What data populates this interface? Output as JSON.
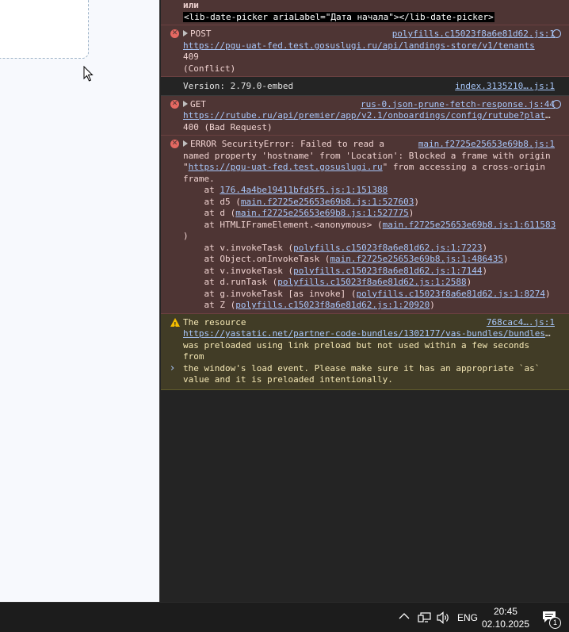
{
  "console": {
    "top_partial": {
      "line1": "или",
      "line2": "<lib-date-picker ariaLabel=\"Дата начала\"></lib-date-picker>"
    },
    "post_error": {
      "method": "POST",
      "source": "polyfills.c15023f8a6e81d62.js:1",
      "url": "https://pgu-uat-fed.test.gosuslugi.ru/api/landings-store/v1/tenants",
      "status_code": "409",
      "status_text": "(Conflict)"
    },
    "version_log": {
      "text": "Version: 2.79.0-embed",
      "source": "index.3135210….js:1"
    },
    "get_error": {
      "method": "GET",
      "source": "rus-0.json-prune-fetch-response.js:44",
      "url": "https://rutube.ru/api/premier/app/v2.1/onboardings/config/rutube?platf…",
      "status": "400 (Bad Request)"
    },
    "security_error": {
      "head": "ERROR SecurityError: Failed to read a",
      "source": "main.f2725e25653e69b8.js:1",
      "line2": "named property 'hostname' from 'Location': Blocked a frame with origin",
      "quote_open": "\"",
      "origin_url": "https://pgu-uat-fed.test.gosuslugi.ru",
      "line3_rest": "\" from accessing a cross-origin",
      "line4": "frame.",
      "stack": [
        {
          "prefix": "    at ",
          "link": "176.4a4be19411bfd5f5.js:1:151388",
          "suffix": ""
        },
        {
          "prefix": "    at d5 (",
          "link": "main.f2725e25653e69b8.js:1:527603",
          "suffix": ")"
        },
        {
          "prefix": "    at d (",
          "link": "main.f2725e25653e69b8.js:1:527775",
          "suffix": ")"
        },
        {
          "prefix": "    at HTMLIFrameElement.<anonymous> (",
          "link": "main.f2725e25653e69b8.js:1:611583",
          "suffix": ""
        },
        {
          "prefix": ")",
          "link": "",
          "suffix": ""
        },
        {
          "prefix": "    at v.invokeTask (",
          "link": "polyfills.c15023f8a6e81d62.js:1:7223",
          "suffix": ")"
        },
        {
          "prefix": "    at Object.onInvokeTask (",
          "link": "main.f2725e25653e69b8.js:1:486435",
          "suffix": ")"
        },
        {
          "prefix": "    at v.invokeTask (",
          "link": "polyfills.c15023f8a6e81d62.js:1:7144",
          "suffix": ")"
        },
        {
          "prefix": "    at d.runTask (",
          "link": "polyfills.c15023f8a6e81d62.js:1:2588",
          "suffix": ")"
        },
        {
          "prefix": "    at g.invokeTask [as invoke] (",
          "link": "polyfills.c15023f8a6e81d62.js:1:8274",
          "suffix": ")"
        },
        {
          "prefix": "    at Z (",
          "link": "polyfills.c15023f8a6e81d62.js:1:20920",
          "suffix": ")"
        }
      ]
    },
    "warning": {
      "head": "The resource",
      "source": "768cac4….js:1",
      "url": "https://yastatic.net/partner-code-bundles/1302177/vas-bundles/bundles-…",
      "line3": "was preloaded using link preload but not used within a few seconds from",
      "line4": "the window's load event. Please make sure it has an appropriate `as`",
      "line5": "value and it is preloaded intentionally."
    },
    "prompt_symbol": "›"
  },
  "taskbar": {
    "language": "ENG",
    "time": "20:45",
    "date": "02.10.2025",
    "notification_count": "1"
  },
  "colors": {
    "console_bg": "#242424",
    "error_bg": "#4e3534",
    "warning_bg": "#413c26",
    "link": "#a8c7fa",
    "error_icon": "#e46962",
    "warning_icon": "#f5bd00"
  }
}
